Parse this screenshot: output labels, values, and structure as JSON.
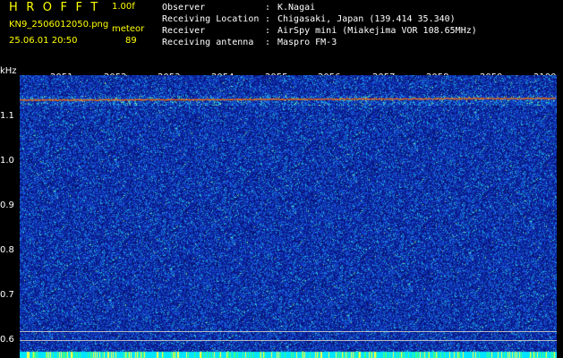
{
  "header": {
    "app_title": "HROFFT",
    "version": "1.00f",
    "filename": "KN9_2506012050.png",
    "timestamp": "25.06.01 20:50",
    "plot_type": "meteor",
    "count": "89"
  },
  "info": [
    {
      "label": "Observer",
      "value": "K.Nagai"
    },
    {
      "label": "Receiving Location",
      "value": "Chigasaki, Japan (139.414 35.340)"
    },
    {
      "label": "Receiver",
      "value": "AirSpy mini (Miakejima VOR 108.65MHz)"
    },
    {
      "label": "Receiving antenna",
      "value": "Maspro FM-3"
    }
  ],
  "axis": {
    "unit": "kHz",
    "y_ticks": [
      "1.1",
      "1.0",
      "0.9",
      "0.8",
      "0.7",
      "0.6"
    ],
    "x_ticks": [
      "2051",
      "2052",
      "2053",
      "2054",
      "2055",
      "2056",
      "2057",
      "2058",
      "2059",
      "2100"
    ]
  },
  "colors": {
    "header_text": "#ffff00",
    "info_text": "#ffffff",
    "spectrum_bg": "#0c2899",
    "carrier_line": "#ff6a00",
    "bottom_band": "#00e5ff"
  }
}
